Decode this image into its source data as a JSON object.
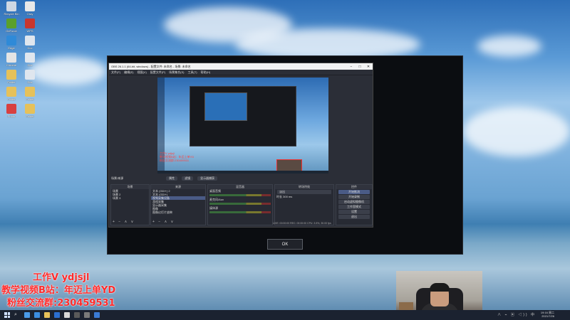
{
  "desktop_icons": [
    {
      "label": "Recycle Bin",
      "color": "#cfd8e3"
    },
    {
      "label": "Oray",
      "color": "#e8e8e8"
    },
    {
      "label": "GeForce",
      "color": "#5aa02c"
    },
    {
      "label": "WPS",
      "color": "#c8362e"
    },
    {
      "label": "Edge",
      "color": "#2f8ad8"
    },
    {
      "label": "Doc",
      "color": "#dfe6ee"
    },
    {
      "label": "Chrome",
      "color": "#e4e4e4"
    },
    {
      "label": "Doc",
      "color": "#dfe6ee"
    },
    {
      "label": "Folder",
      "color": "#e6c15a"
    },
    {
      "label": "Doc",
      "color": "#dfe6ee"
    },
    {
      "label": "Folder",
      "color": "#e6c15a"
    },
    {
      "label": "Folder",
      "color": "#e6c15a"
    },
    {
      "label": "Photo",
      "color": "#d84040"
    },
    {
      "label": "Folder",
      "color": "#e6c15a"
    }
  ],
  "obs": {
    "title": "OBS 26.1.1 (64-bit, windows) - 配置文件: 未命名 - 场景: 未命名",
    "menu": [
      "文件(F)",
      "编辑(E)",
      "视图(V)",
      "配置文件(P)",
      "场景集合(S)",
      "工具(T)",
      "帮助(H)"
    ],
    "preview_text": "工作V ydjsjl\n教学视频B站: 年迈上单YD\n粉丝交流群",
    "tab_row_label": "场景/来源",
    "tabs": [
      "属性",
      "滤镜",
      "显示器捕获"
    ],
    "scenes_header": "场景",
    "scenes": [
      "场景",
      "场景 2",
      "场景 3"
    ],
    "sources_header": "来源",
    "sources": [
      "文本 (GDI+) 2",
      "文本 (GDI+)",
      "视频采集设备",
      "游戏采集",
      "显示器采集",
      "图像",
      "图像幻灯片放映"
    ],
    "mixer_header": "混音器",
    "mixer_items": [
      "桌面音频",
      "麦克风/Aux",
      "媒体源"
    ],
    "transitions_header": "转场特效",
    "transition_value": "淡出",
    "duration_label": "时长",
    "duration_value": "300 ms",
    "controls_header": "控件",
    "controls": [
      "开始推流",
      "开始录制",
      "启动虚拟摄像机",
      "工作室模式",
      "设置",
      "退出"
    ],
    "status": "LIVE: 00:00:00   REC: 00:00:00   CPU: 3.5%, 30.00 fps",
    "dock_footer": "+ − ∧ ∨"
  },
  "dialog": {
    "ok_label": "OK"
  },
  "overlay": {
    "line1": "工作V ydjsjl",
    "line2": "教学视频B站：年迈上单YD",
    "line3": "粉丝交流群:230459531",
    "color": "#ff2a2a"
  },
  "taskbar": {
    "time": "19:16",
    "date": "2021/7/26",
    "weekday": "周二",
    "tray_icons": "∧ ⌁ ▣ ◁)) 中"
  }
}
